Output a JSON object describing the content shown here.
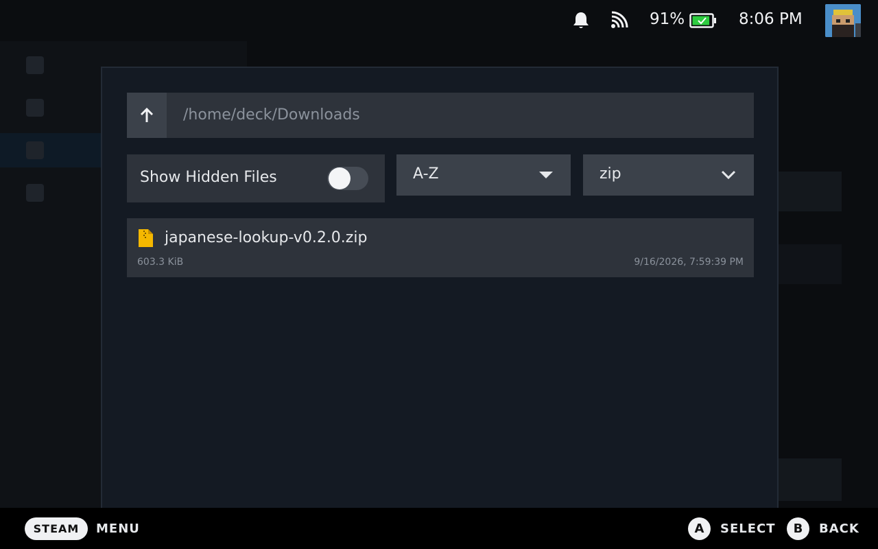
{
  "status_bar": {
    "battery_percent": "91%",
    "battery_level": 0.91,
    "battery_color": "#2ecc40",
    "time": "8:06 PM",
    "icons": [
      "bell-icon",
      "wifi-icon",
      "battery-icon",
      "avatar"
    ]
  },
  "file_picker": {
    "path": "/home/deck/Downloads",
    "up_icon": "arrow-up-icon",
    "show_hidden_label": "Show Hidden Files",
    "show_hidden_enabled": false,
    "sort_selected": "A-Z",
    "filter_selected": "zip",
    "files": [
      {
        "name": "japanese-lookup-v0.2.0.zip",
        "size": "603.3 KiB",
        "modified": "9/16/2026, 7:59:39 PM",
        "icon": "zip-file-icon",
        "icon_color": "#f5b800"
      }
    ]
  },
  "bottom_bar": {
    "steam_label": "STEAM",
    "menu_label": "MENU",
    "a_glyph": "A",
    "select_label": "SELECT",
    "b_glyph": "B",
    "back_label": "BACK"
  }
}
